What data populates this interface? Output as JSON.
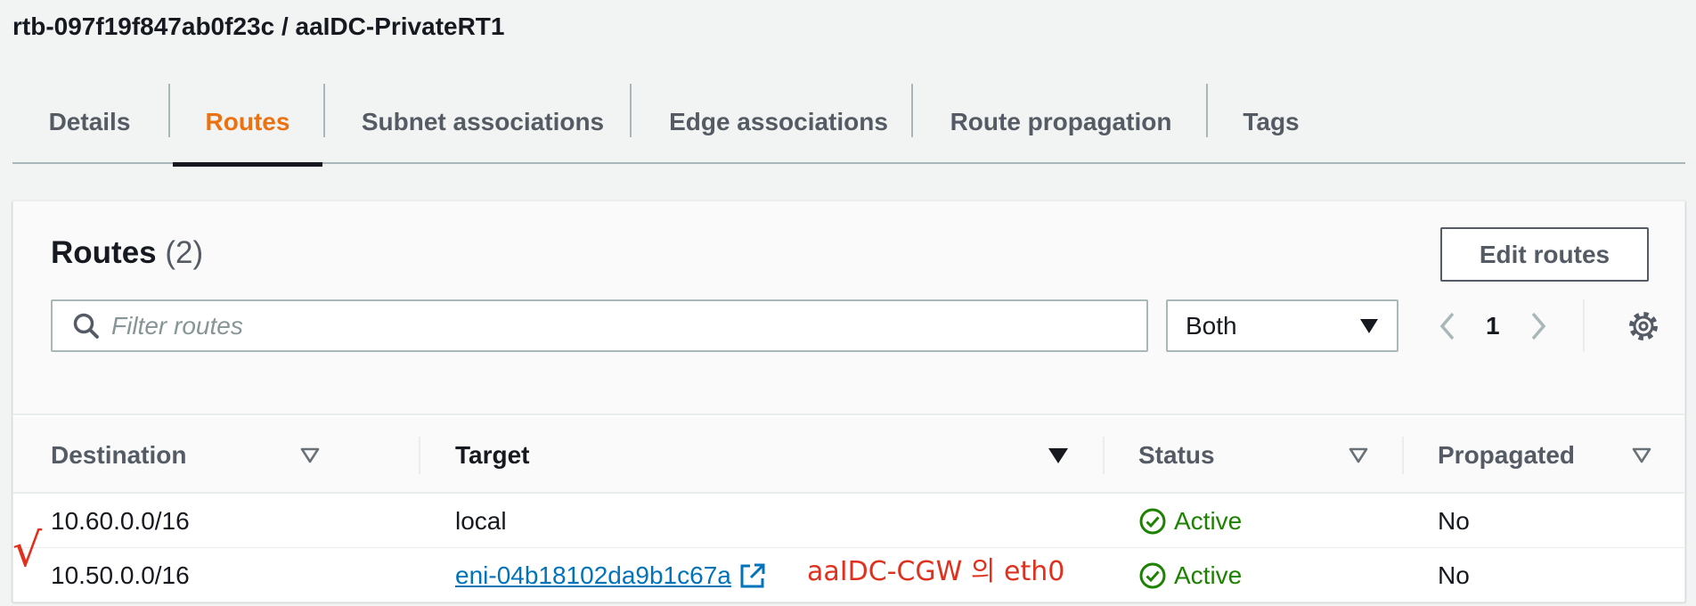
{
  "page": {
    "title": "rtb-097f19f847ab0f23c / aaIDC-PrivateRT1"
  },
  "tabs": [
    {
      "label": "Details"
    },
    {
      "label": "Routes",
      "active": true
    },
    {
      "label": "Subnet associations"
    },
    {
      "label": "Edge associations"
    },
    {
      "label": "Route propagation"
    },
    {
      "label": "Tags"
    }
  ],
  "routes_panel": {
    "title": "Routes",
    "count": "(2)",
    "edit_button": "Edit routes",
    "search_placeholder": "Filter routes",
    "filter_select": "Both",
    "page_number": "1"
  },
  "table": {
    "columns": [
      "Destination",
      "Target",
      "Status",
      "Propagated"
    ],
    "rows": [
      {
        "destination": "10.60.0.0/16",
        "target": "local",
        "target_is_link": false,
        "status": "Active",
        "propagated": "No"
      },
      {
        "destination": "10.50.0.0/16",
        "target": "eni-04b18102da9b1c67a",
        "target_is_link": true,
        "status": "Active",
        "propagated": "No"
      }
    ]
  },
  "annotations": {
    "note": "aaIDC-CGW 의 eth0",
    "check_mark": "√"
  },
  "colors": {
    "accent": "#ec7211",
    "link": "#0073bb",
    "success": "#1d8102",
    "annotation": "#e0301e"
  },
  "icons": [
    "search-icon",
    "caret-down-icon",
    "chevron-left-icon",
    "chevron-right-icon",
    "gear-icon",
    "sort-icon",
    "external-link-icon",
    "status-success-icon"
  ]
}
